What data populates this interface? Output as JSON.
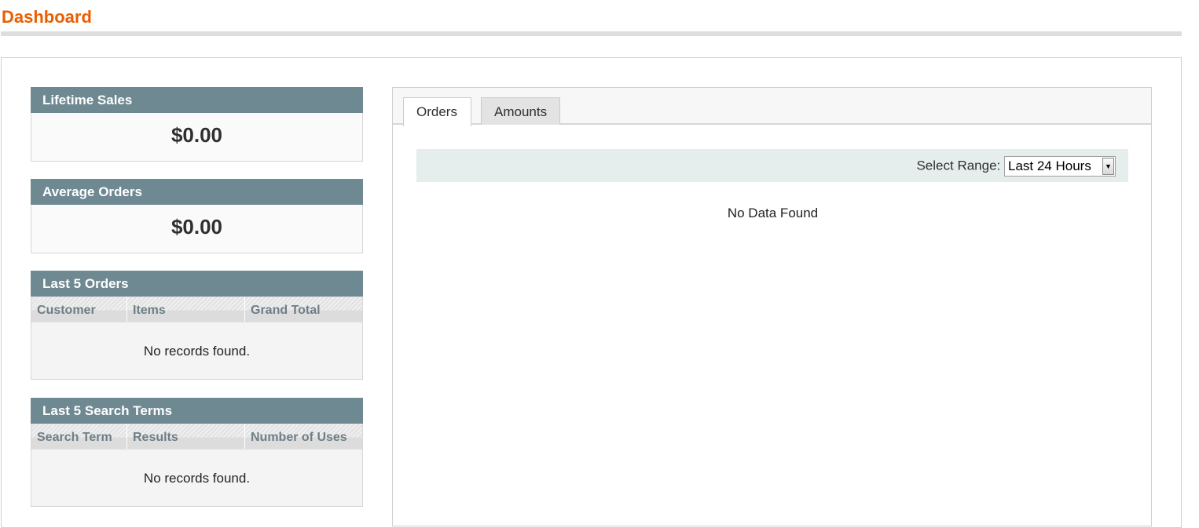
{
  "page": {
    "title": "Dashboard"
  },
  "lifetime_sales": {
    "label": "Lifetime Sales",
    "value": "$0.00"
  },
  "average_orders": {
    "label": "Average Orders",
    "value": "$0.00"
  },
  "last_orders": {
    "label": "Last 5 Orders",
    "columns": [
      "Customer",
      "Items",
      "Grand Total"
    ],
    "empty": "No records found."
  },
  "last_search": {
    "label": "Last 5 Search Terms",
    "columns": [
      "Search Term",
      "Results",
      "Number of Uses"
    ],
    "empty": "No records found."
  },
  "chart": {
    "tabs": [
      {
        "label": "Orders",
        "active": true
      },
      {
        "label": "Amounts",
        "active": false
      }
    ],
    "range_label": "Select Range:",
    "range_value": "Last 24 Hours",
    "empty": "No Data Found"
  }
}
